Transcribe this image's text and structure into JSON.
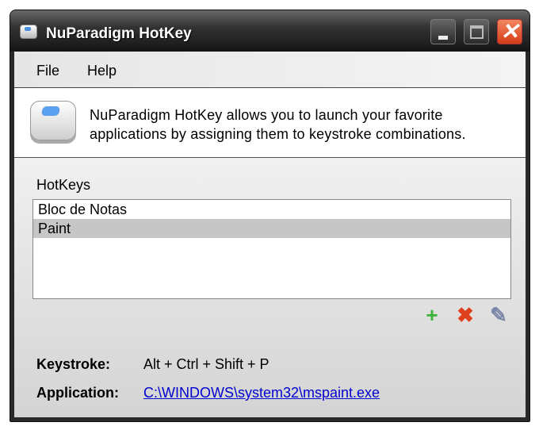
{
  "window": {
    "title": "NuParadigm HotKey",
    "close_glyph": "✕"
  },
  "menu": {
    "items": [
      "File",
      "Help"
    ]
  },
  "description": {
    "line1": "NuParadigm HotKey allows you to launch your favorite",
    "line2": "applications by assigning them to keystroke combinations."
  },
  "hotkeys": {
    "label": "HotKeys",
    "items": [
      {
        "label": "Bloc de Notas",
        "selected": false
      },
      {
        "label": "Paint",
        "selected": true
      }
    ]
  },
  "toolbar": {
    "add": "+",
    "delete": "✖",
    "edit": "✎"
  },
  "details": {
    "keystroke_label": "Keystroke:",
    "keystroke_value": "Alt + Ctrl + Shift + P",
    "application_label": "Application:",
    "application_value": "C:\\WINDOWS\\system32\\mspaint.exe"
  }
}
